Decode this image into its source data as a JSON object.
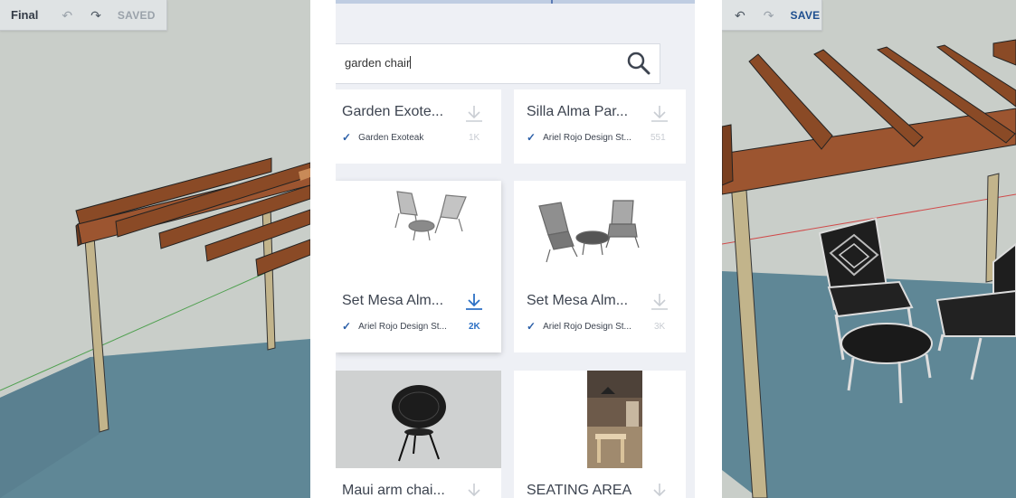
{
  "left_app": {
    "title": "Final",
    "undo_icon": "undo-icon",
    "redo_icon": "redo-icon",
    "status": "SAVED"
  },
  "right_app": {
    "undo_icon": "undo-icon",
    "redo_icon": "redo-icon",
    "save_label": "SAVE"
  },
  "search": {
    "value": "garden chair",
    "icon": "search-icon"
  },
  "results": [
    {
      "title": "Garden Exote...",
      "author": "Garden Exoteak",
      "count": "1K",
      "verified": true,
      "active": false
    },
    {
      "title": "Silla Alma Par...",
      "author": "Ariel Rojo Design St...",
      "count": "551",
      "verified": true,
      "active": false
    },
    {
      "title": "Set Mesa Alm...",
      "author": "Ariel Rojo Design St...",
      "count": "2K",
      "verified": true,
      "active": true
    },
    {
      "title": "Set Mesa Alm...",
      "author": "Ariel Rojo Design St...",
      "count": "3K",
      "verified": true,
      "active": false
    },
    {
      "title": "Maui arm chai...",
      "author": "",
      "count": "",
      "verified": false,
      "active": false
    },
    {
      "title": "SEATING AREA",
      "author": "",
      "count": "",
      "verified": false,
      "active": false
    }
  ],
  "colors": {
    "accent": "#2b5fa8",
    "wood": "#8a4a26",
    "floor": "#5f8796",
    "viewport_bg": "#c9cec9"
  }
}
